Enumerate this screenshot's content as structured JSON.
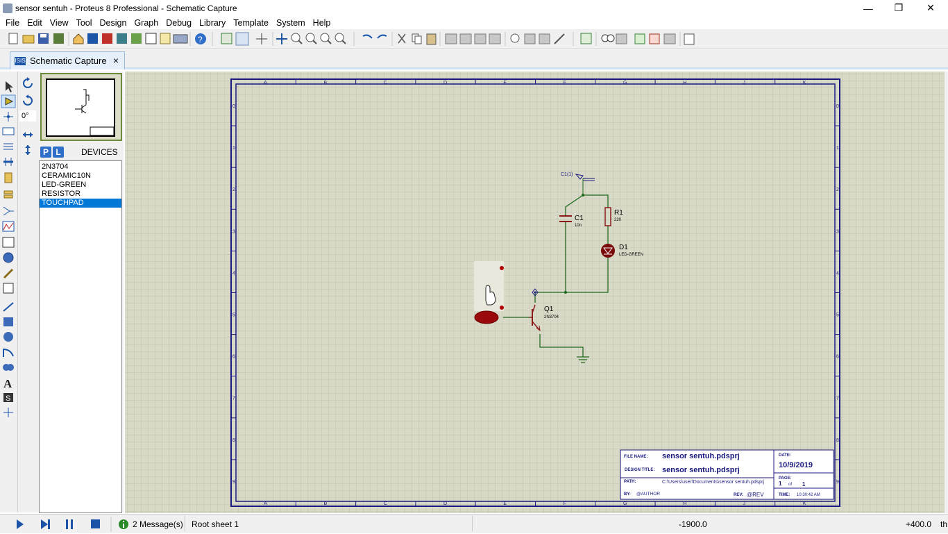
{
  "window": {
    "title": "sensor sentuh - Proteus 8 Professional - Schematic Capture",
    "minimize": "—",
    "maximize": "❐",
    "close": "✕"
  },
  "menu": [
    "File",
    "Edit",
    "View",
    "Tool",
    "Design",
    "Graph",
    "Debug",
    "Library",
    "Template",
    "System",
    "Help"
  ],
  "tab": {
    "label": "Schematic Capture",
    "close": "×"
  },
  "rotation": "0°",
  "devices": {
    "header": "DEVICES",
    "p_label": "P",
    "l_label": "L",
    "items": [
      "2N3704",
      "CERAMIC10N",
      "LED-GREEN",
      "RESISTOR",
      "TOUCHPAD"
    ],
    "selected": "TOUCHPAD"
  },
  "sheet": {
    "cols": [
      "A",
      "B",
      "C",
      "D",
      "E",
      "F",
      "G",
      "H",
      "J",
      "K"
    ],
    "rows": [
      "0",
      "1",
      "2",
      "3",
      "4",
      "5",
      "6",
      "7",
      "8",
      "9"
    ]
  },
  "schematic": {
    "c1_label": "C1",
    "c1_value": "10n",
    "r1_label": "R1",
    "r1_value": "220",
    "d1_label": "D1",
    "d1_value": "LED-GREEN",
    "q1_label": "Q1",
    "q1_value": "2N3704",
    "terminal_label": "C1(1)"
  },
  "titleblock": {
    "file_name_label": "FILE NAME:",
    "file_name": "sensor sentuh.pdsprj",
    "design_title_label": "DESIGN TITLE:",
    "design_title": "sensor sentuh.pdsprj",
    "path_label": "PATH:",
    "path": "C:\\Users\\user\\Documents\\sensor sentuh.pdsprj",
    "by_label": "BY:",
    "by": "@AUTHOR",
    "rev_label": "REV:",
    "rev": "@REV",
    "date_label": "DATE:",
    "date": "10/9/2019",
    "page_label": "PAGE:",
    "page_value": "1",
    "page_of": "of",
    "page_total": "1",
    "time_label": "TIME:",
    "time": "10:30:42 AM"
  },
  "status": {
    "messages": "2 Message(s)",
    "sheet": "Root sheet 1",
    "x_coord": "-1900.0",
    "y_coord": "+400.0",
    "units": "th"
  },
  "colors": {
    "sheet_border": "#1a1a80",
    "canvas_bg": "#d9d9c7",
    "grid": "#c2c2ad",
    "wire": "#1e6b1e",
    "component": "#8b1a1a",
    "selection": "#0078d7"
  }
}
